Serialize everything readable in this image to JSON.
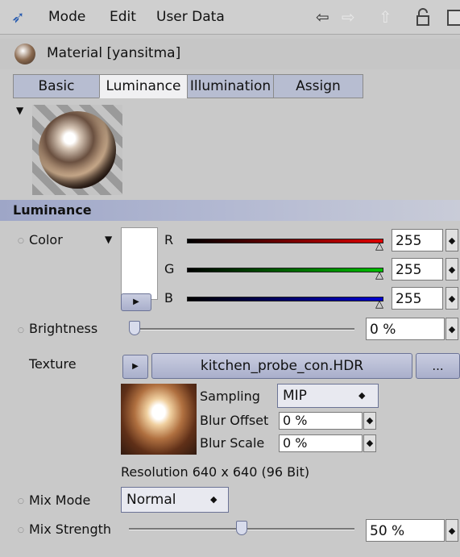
{
  "menubar": {
    "items": [
      "Mode",
      "Edit",
      "User Data"
    ],
    "icons": [
      "cursor-icon",
      "back-arrow-icon",
      "forward-arrow-icon",
      "up-arrow-icon",
      "lock-icon",
      "window-icon"
    ]
  },
  "material": {
    "title": "Material [yansitma]"
  },
  "tabs": [
    {
      "label": "Basic",
      "active": false
    },
    {
      "label": "Luminance",
      "active": true
    },
    {
      "label": "Illumination",
      "active": false
    },
    {
      "label": "Assign",
      "active": false
    }
  ],
  "section": {
    "title": "Luminance"
  },
  "color": {
    "label": "Color",
    "swatch": "#ffffff",
    "channels": [
      {
        "name": "R",
        "value": "255",
        "color": "#e00000"
      },
      {
        "name": "G",
        "value": "255",
        "color": "#00c000"
      },
      {
        "name": "B",
        "value": "255",
        "color": "#0000d0"
      }
    ]
  },
  "brightness": {
    "label": "Brightness",
    "value": "0 %",
    "level": 0
  },
  "texture": {
    "label": "Texture",
    "file": "kitchen_probe_con.HDR",
    "more": "...",
    "sampling_label": "Sampling",
    "sampling_value": "MIP",
    "blur_offset_label": "Blur Offset",
    "blur_offset_value": "0 %",
    "blur_scale_label": "Blur Scale",
    "blur_scale_value": "0 %",
    "resolution": "Resolution 640 x 640  (96 Bit)"
  },
  "mix_mode": {
    "label": "Mix Mode",
    "value": "Normal"
  },
  "mix_strength": {
    "label": "Mix Strength",
    "value": "50 %",
    "level": 50
  }
}
